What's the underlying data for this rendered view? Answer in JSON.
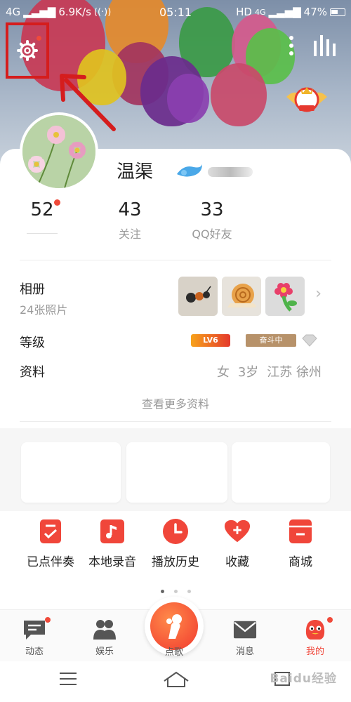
{
  "status_bar": {
    "network": "4G",
    "speed": "6.9K/s",
    "time": "05:11",
    "hd": "HD",
    "network2": "4G",
    "battery": "47%"
  },
  "profile": {
    "username": "温渠",
    "stats": [
      {
        "value": "52",
        "label": ""
      },
      {
        "value": "43",
        "label": "关注"
      },
      {
        "value": "33",
        "label": "QQ好友"
      }
    ]
  },
  "album": {
    "title": "相册",
    "count": "24张照片"
  },
  "level": {
    "title": "等级",
    "lv": "LV6",
    "rank": "奋斗中"
  },
  "info": {
    "title": "资料",
    "gender": "女",
    "age": "3岁",
    "location": "江苏 徐州"
  },
  "more_info": "查看更多资料",
  "shortcuts": [
    {
      "label": "已点伴奏",
      "icon": "checklist-icon"
    },
    {
      "label": "本地录音",
      "icon": "music-note-icon"
    },
    {
      "label": "播放历史",
      "icon": "clock-icon"
    },
    {
      "label": "收藏",
      "icon": "heart-plus-icon"
    },
    {
      "label": "商城",
      "icon": "store-icon"
    }
  ],
  "tabs": [
    {
      "label": "动态",
      "icon": "message-icon"
    },
    {
      "label": "娱乐",
      "icon": "people-icon"
    },
    {
      "label": "点歌",
      "icon": "singer-icon"
    },
    {
      "label": "消息",
      "icon": "mail-icon"
    },
    {
      "label": "我的",
      "icon": "mascot-icon"
    }
  ],
  "watermark": "Baidu经验",
  "colors": {
    "accent": "#f0463a",
    "annotation": "#d51d1d"
  }
}
